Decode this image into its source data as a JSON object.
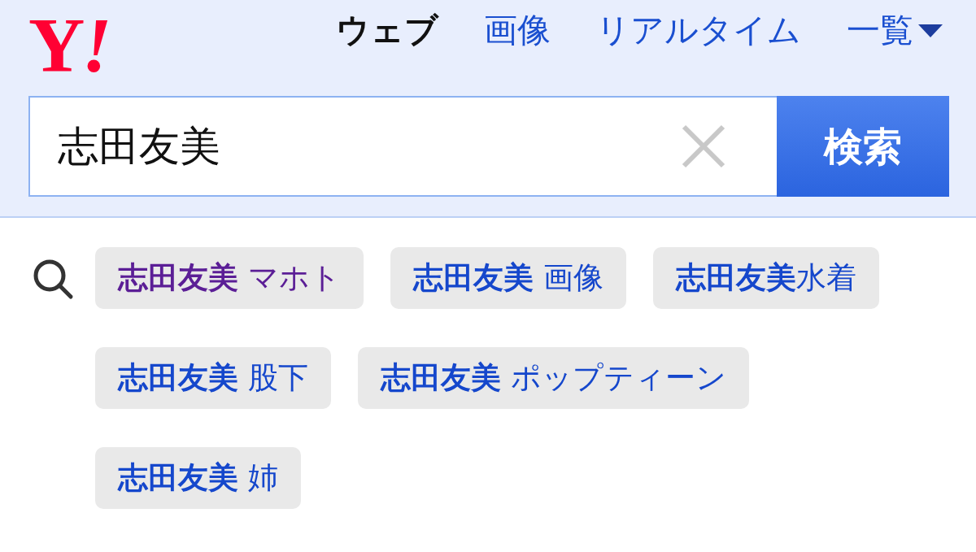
{
  "logo": "Y!",
  "tabs": [
    {
      "label": "ウェブ",
      "selected": true,
      "kind": "link"
    },
    {
      "label": "画像",
      "selected": false,
      "kind": "link"
    },
    {
      "label": "リアルタイム",
      "selected": false,
      "kind": "link"
    },
    {
      "label": "一覧",
      "selected": false,
      "kind": "menu"
    }
  ],
  "search": {
    "value": "志田友美",
    "button": "検索"
  },
  "suggestions": [
    {
      "query": "志田友美",
      "suffix": " マホト",
      "visited": true
    },
    {
      "query": "志田友美",
      "suffix": " 画像",
      "visited": false
    },
    {
      "query": "志田友美",
      "suffix": "水着",
      "visited": false
    },
    {
      "query": "志田友美",
      "suffix": " 股下",
      "visited": false
    },
    {
      "query": "志田友美",
      "suffix": " ポップティーン",
      "visited": false
    },
    {
      "query": "志田友美",
      "suffix": " 姉",
      "visited": false
    }
  ]
}
